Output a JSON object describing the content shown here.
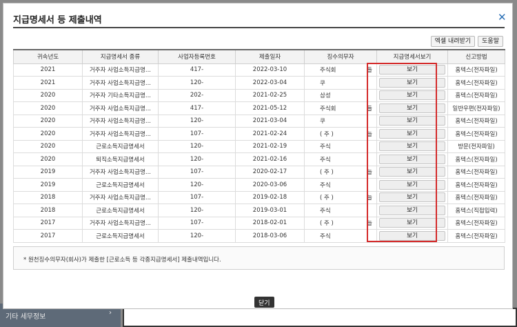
{
  "modal": {
    "title": "지급명세서 등 제출내역",
    "excel_label": "엑셀 내려받기",
    "help_label": "도움말",
    "note": "* 원천징수의무자(회사)가 제출한 [근로소득 등 각종지급명세서] 제출내역입니다.",
    "close_label": "닫기"
  },
  "background": {
    "panel_label": "기타 세무정보",
    "chevron": "›"
  },
  "table": {
    "headers": [
      "귀속년도",
      "지급명세서 종류",
      "사업자등록번호",
      "제출일자",
      "징수의무자",
      "지급명세서보기",
      "신고방법"
    ],
    "rows": [
      {
        "year": "2021",
        "type": "거주자 사업소득지급명...",
        "bizno": "417-",
        "date": "2022-03-10",
        "payer": "주식회",
        "payer_tail": "들",
        "view": "보기",
        "method": "홈텍스(전자파일)"
      },
      {
        "year": "2021",
        "type": "거주자 사업소득지급명...",
        "bizno": "120-",
        "date": "2022-03-04",
        "payer": "쿠",
        "payer_tail": "",
        "view": "보기",
        "method": "홈텍스(전자파일)"
      },
      {
        "year": "2020",
        "type": "거주자 기타소득지급명...",
        "bizno": "202-",
        "date": "2021-02-25",
        "payer": "삼성",
        "payer_tail": "",
        "view": "보기",
        "method": "홈텍스(전자파일)"
      },
      {
        "year": "2020",
        "type": "거주자 사업소득지급명...",
        "bizno": "417-",
        "date": "2021-05-12",
        "payer": "주식회",
        "payer_tail": "들",
        "view": "보기",
        "method": "일반우편(전자파일)"
      },
      {
        "year": "2020",
        "type": "거주자 사업소득지급명...",
        "bizno": "120-",
        "date": "2021-03-04",
        "payer": "쿠",
        "payer_tail": "",
        "view": "보기",
        "method": "홈텍스(전자파일)"
      },
      {
        "year": "2020",
        "type": "거주자 사업소득지급명...",
        "bizno": "107-",
        "date": "2021-02-24",
        "payer": "( 주 )",
        "payer_tail": "늘",
        "view": "보기",
        "method": "홈텍스(전자파일)"
      },
      {
        "year": "2020",
        "type": "근로소득지급명세서",
        "bizno": "120-",
        "date": "2021-02-19",
        "payer": "주식",
        "payer_tail": "",
        "view": "보기",
        "method": "방문(전자파일)"
      },
      {
        "year": "2020",
        "type": "퇴직소득지급명세서",
        "bizno": "120-",
        "date": "2021-02-16",
        "payer": "주식",
        "payer_tail": "",
        "view": "보기",
        "method": "홈텍스(전자파일)"
      },
      {
        "year": "2019",
        "type": "거주자 사업소득지급명...",
        "bizno": "107-",
        "date": "2020-02-17",
        "payer": "( 주 )",
        "payer_tail": "늘",
        "view": "보기",
        "method": "홈텍스(전자파일)"
      },
      {
        "year": "2019",
        "type": "근로소득지급명세서",
        "bizno": "120-",
        "date": "2020-03-06",
        "payer": "주식",
        "payer_tail": "",
        "view": "보기",
        "method": "홈텍스(전자파일)"
      },
      {
        "year": "2018",
        "type": "거주자 사업소득지급명...",
        "bizno": "107-",
        "date": "2019-02-18",
        "payer": "( 주 )",
        "payer_tail": "늘",
        "view": "보기",
        "method": "홈텍스(전자파일)"
      },
      {
        "year": "2018",
        "type": "근로소득지급명세서",
        "bizno": "120-",
        "date": "2019-03-01",
        "payer": "주식",
        "payer_tail": "",
        "view": "보기",
        "method": "홈텍스(직접입력)"
      },
      {
        "year": "2017",
        "type": "거주자 사업소득지급명...",
        "bizno": "107-",
        "date": "2018-02-01",
        "payer": "( 주 )",
        "payer_tail": "늘",
        "view": "보기",
        "method": "홈텍스(전자파일)"
      },
      {
        "year": "2017",
        "type": "근로소득지급명세서",
        "bizno": "120-",
        "date": "2018-03-06",
        "payer": "주식",
        "payer_tail": "",
        "view": "보기",
        "method": "홈텍스(전자파일)"
      }
    ]
  },
  "colors": {
    "highlight": "#d42a2a",
    "close_icon": "#2a6fb5"
  },
  "icons": {
    "close": "close-icon"
  }
}
